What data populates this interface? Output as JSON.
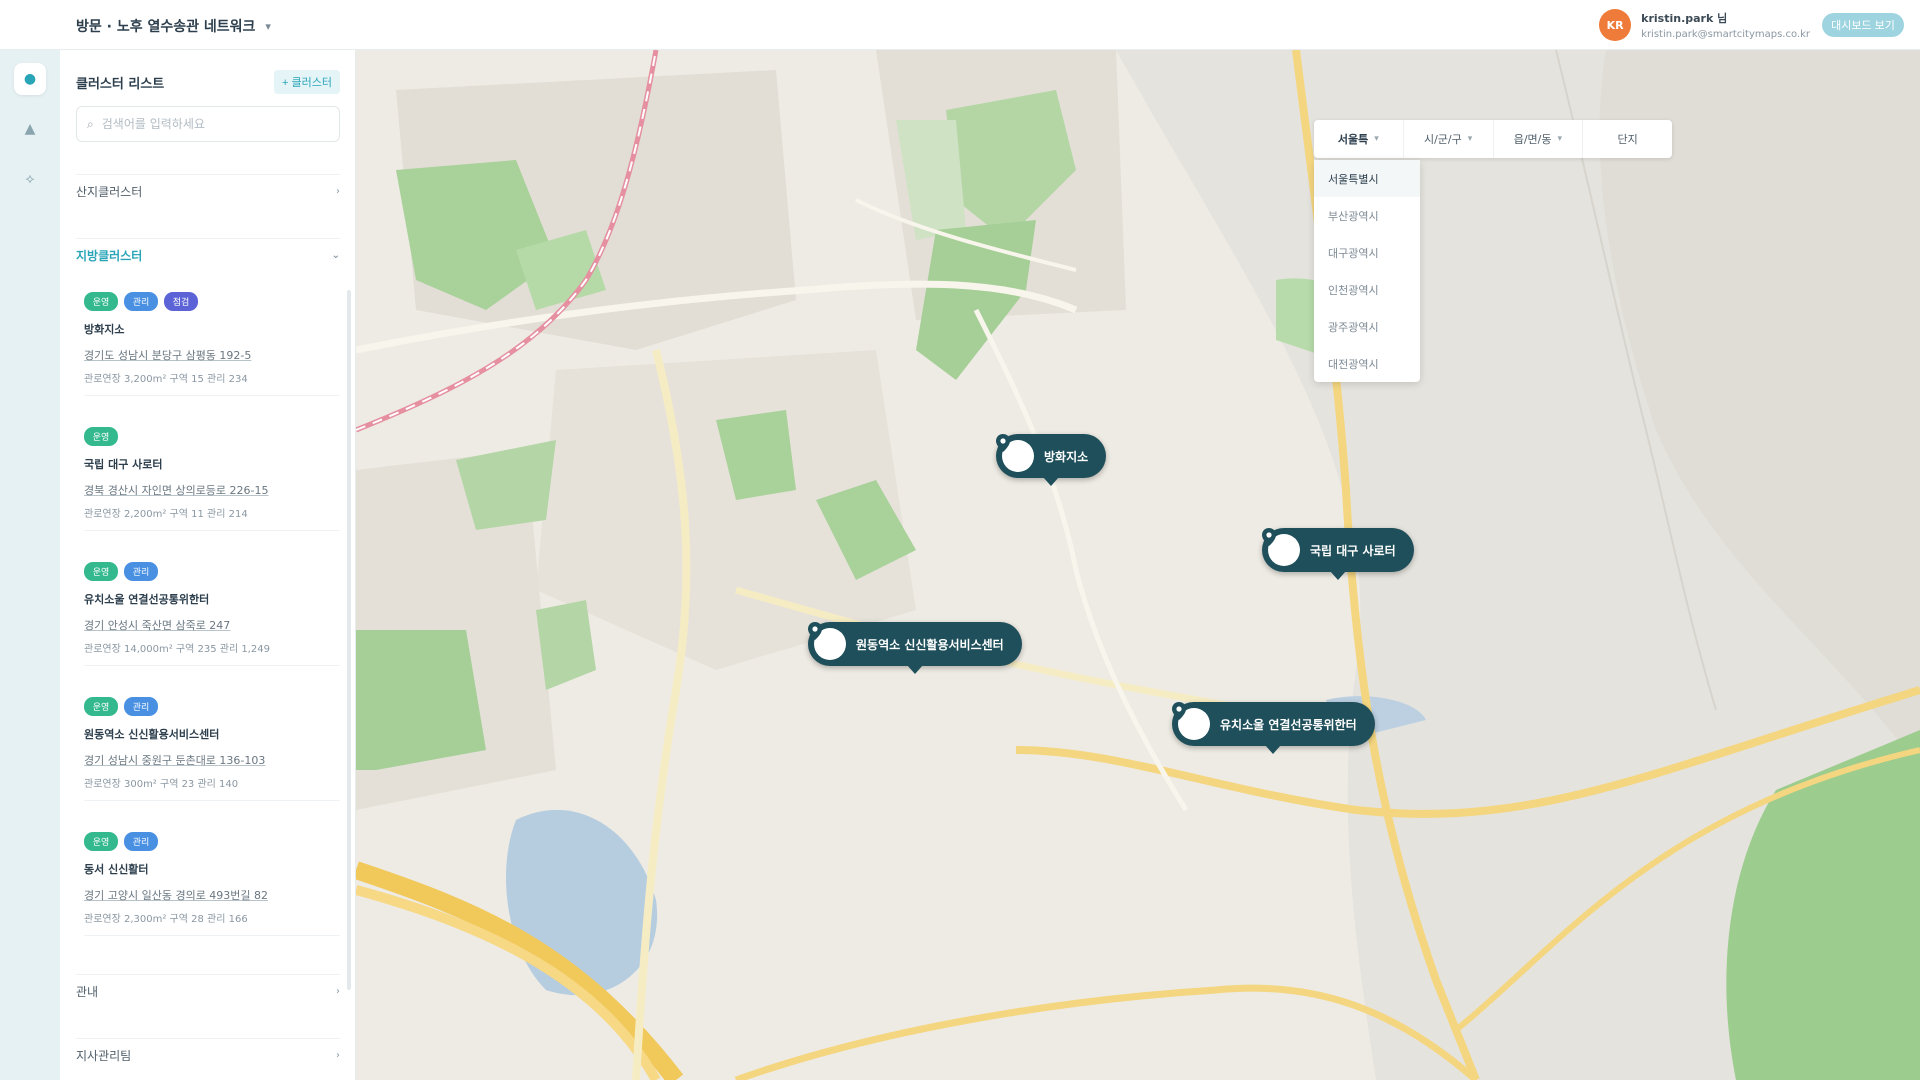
{
  "header": {
    "project_title": "방문 · 노후 열수송관 네트워크",
    "user_initials": "KR",
    "user_name": "kristin.park 님",
    "user_email": "kristin.park@smartcitymaps.co.kr",
    "action_label": "대시보드 보기"
  },
  "rail": {
    "items": [
      {
        "icon": "location-icon",
        "glyph": "●"
      },
      {
        "icon": "building-icon",
        "glyph": "▲"
      },
      {
        "icon": "share-icon",
        "glyph": "⟡"
      }
    ]
  },
  "panel": {
    "title": "클러스터 리스트",
    "add_label": "+ 클러스터",
    "search_placeholder": "검색어를 입력하세요",
    "sections": [
      {
        "label": "산지클러스터",
        "expanded": false
      },
      {
        "label": "지방클러스터",
        "expanded": true
      },
      {
        "label": "관내",
        "expanded": false
      },
      {
        "label": "지사관리팀",
        "expanded": false
      }
    ],
    "cards": [
      {
        "badges": [
          {
            "label": "운영",
            "color": "#34b98f"
          },
          {
            "label": "관리",
            "color": "#4a90e2"
          },
          {
            "label": "점검",
            "color": "#5b63d6"
          }
        ],
        "name": "방화지소",
        "address": "경기도 성남시 분당구 삼평동 192-5",
        "meta": "관로연장 3,200m²  구역 15  관리 234"
      },
      {
        "badges": [
          {
            "label": "운영",
            "color": "#34b98f"
          }
        ],
        "name": "국립 대구 사로터",
        "address": "경북 경산시 자인면 상의로등로 226-15",
        "meta": "관로연장 2,200m²  구역 11  관리 214"
      },
      {
        "badges": [
          {
            "label": "운영",
            "color": "#34b98f"
          },
          {
            "label": "관리",
            "color": "#4a90e2"
          }
        ],
        "name": "유치소울 연결선공통위한터",
        "address": "경기 안성시 죽산면 삼죽로 247",
        "meta": "관로연장 14,000m²  구역 235  관리 1,249"
      },
      {
        "badges": [
          {
            "label": "운영",
            "color": "#34b98f"
          },
          {
            "label": "관리",
            "color": "#4a90e2"
          }
        ],
        "name": "원동역소 신신활용서비스센터",
        "address": "경기 성남시 중원구 둔촌대로 136-103",
        "meta": "관로연장 300m²  구역 23  관리 140"
      },
      {
        "badges": [
          {
            "label": "운영",
            "color": "#34b98f"
          },
          {
            "label": "관리",
            "color": "#4a90e2"
          }
        ],
        "name": "동서 신신활터",
        "address": "경기 고양시 일산동 경의로 493번길 82",
        "meta": "관로연장 2,300m²  구역 28  관리 166"
      }
    ]
  },
  "map": {
    "filters": [
      {
        "label": "서울특",
        "selected": true
      },
      {
        "label": "시/군/구",
        "selected": false
      },
      {
        "label": "읍/면/동",
        "selected": false
      },
      {
        "label": "단지",
        "selected": false
      }
    ],
    "dropdown_options": [
      "서울특별시",
      "부산광역시",
      "대구광역시",
      "인천광역시",
      "광주광역시",
      "대전광역시"
    ],
    "markers": [
      {
        "label": "방화지소"
      },
      {
        "label": "국립 대구 사로터"
      },
      {
        "label": "원동역소 신신활용서비스센터"
      },
      {
        "label": "유치소울 연결선공통위한터"
      }
    ]
  }
}
